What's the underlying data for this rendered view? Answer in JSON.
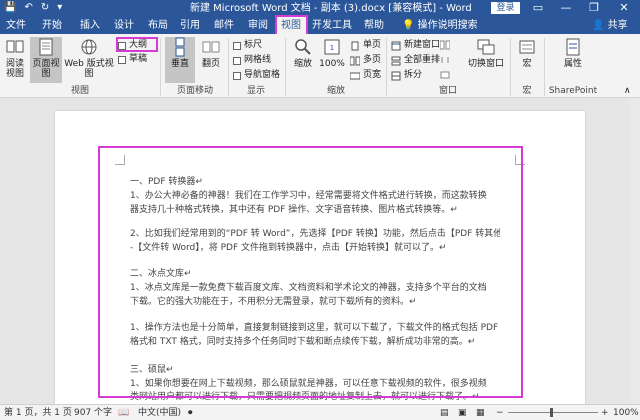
{
  "titlebar": {
    "title": "新建 Microsoft Word 文档 - 副本 (3).docx [兼容模式] - Word",
    "signin": "登录",
    "minimize": "—",
    "restore": "❐",
    "close": "✕"
  },
  "tabs": [
    {
      "label": "文件"
    },
    {
      "label": "开始"
    },
    {
      "label": "插入"
    },
    {
      "label": "设计"
    },
    {
      "label": "布局"
    },
    {
      "label": "引用"
    },
    {
      "label": "邮件"
    },
    {
      "label": "审阅"
    },
    {
      "label": "视图"
    },
    {
      "label": "开发工具"
    },
    {
      "label": "帮助"
    }
  ],
  "tellme": "操作说明搜索",
  "share": "共享",
  "ribbon": {
    "views": {
      "read_mode": "阅读视图",
      "print_layout": "页面视图",
      "web_layout": "Web 版式视图",
      "outline": "大纲",
      "draft": "草稿",
      "label": "视图"
    },
    "page_move": {
      "vertical": "垂直",
      "side_by_side": "翻页",
      "label": "页面移动"
    },
    "show": {
      "ruler": "标尺",
      "gridlines": "网格线",
      "nav_pane": "导航窗格",
      "label": "显示"
    },
    "zoom": {
      "zoom": "缩放",
      "hundred": "100%",
      "one_page": "单页",
      "multi_page": "多页",
      "page_width": "页宽",
      "label": "缩放"
    },
    "window": {
      "new_window": "新建窗口",
      "arrange_all": "全部重排",
      "split": "拆分",
      "switch_window": "切换窗口",
      "label": "窗口"
    },
    "macros": {
      "macros": "宏",
      "label": "宏"
    },
    "sharepoint": {
      "properties": "属性",
      "label": "SharePoint"
    }
  },
  "document": {
    "lines": [
      "一、PDF 转换器↵",
      "1、办公大神必备的神器！我们在工作学习中，经常需要将文件格式进行转换，而这款转换",
      "器支持几十种格式转换，其中还有 PDF 操作、文字语音转换、图片格式转换等。↵",
      "",
      "2、比如我们经常用到的“PDF 转 Word”，先选择【PDF 转换】功能，然后点击【PDF 转其他】",
      "-【文件转 Word】，将 PDF 文件拖到转换器中，点击【开始转换】就可以了。↵",
      "",
      "二、冰点文库↵",
      "1、冰点文库是一款免费下载百度文库、文档资料和学术论文的神器，支持多个平台的文档",
      "下载。它的强大功能在于，不用积分无需登录，就可下载所有的资料。↵",
      "",
      "1、操作方法也是十分简单，直接复制链接到这里，就可以下载了，下载文件的格式包括 PDF",
      "格式和 TXT 格式，同时支持多个任务同时下载和断点续传下载，解析成功非常的高。↵",
      "",
      "三、硕鼠↵",
      "1、如果你想要在网上下载视频，那么硕鼠就是神器，可以任意下载视频的软件，很多视频",
      "类网站用户都可以进行下载，只需要把视频页面的地址复制上去，就可以进行下载了。↵"
    ]
  },
  "statusbar": {
    "page": "第 1 页，共 1 页",
    "words": "907 个字",
    "language": "中文(中国)",
    "zoom": "100%"
  },
  "colors": {
    "brand": "#2b579a",
    "highlight": "#d63bd6"
  }
}
